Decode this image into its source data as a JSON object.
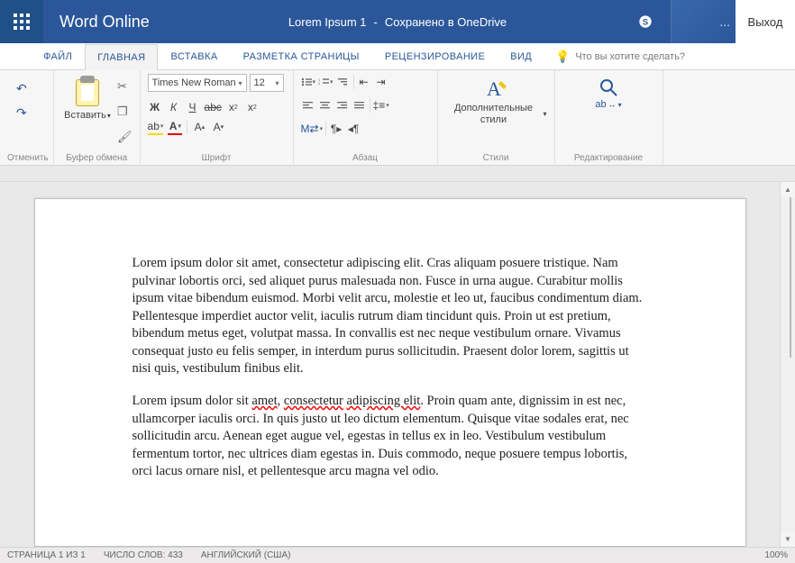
{
  "titlebar": {
    "app_name": "Word Online",
    "doc_name": "Lorem Ipsum 1",
    "save_status": "Сохранено в OneDrive",
    "ellipsis": "...",
    "exit": "Выход"
  },
  "tabs": {
    "file": "ФАЙЛ",
    "home": "ГЛАВНАЯ",
    "insert": "ВСТАВКА",
    "layout": "РАЗМЕТКА СТРАНИЦЫ",
    "review": "РЕЦЕНЗИРОВАНИЕ",
    "view": "ВИД",
    "tell_me": "Что вы хотите сделать?"
  },
  "ribbon": {
    "undo_group": "Отменить",
    "clipboard_group": "Буфер обмена",
    "paste": "Вставить",
    "font_group": "Шрифт",
    "font_name": "Times New Roman",
    "font_size": "12",
    "paragraph_group": "Абзац",
    "styles_group": "Стили",
    "styles_btn": "Дополнительные стили",
    "editing_group": "Редактирование",
    "find_icon_label": "ab"
  },
  "document": {
    "para1": "Lorem ipsum dolor sit amet, consectetur adipiscing elit. Cras aliquam posuere tristique. Nam pulvinar lobortis orci, sed aliquet purus malesuada non. Fusce in urna augue. Curabitur mollis ipsum vitae bibendum euismod. Morbi velit arcu, molestie et leo ut, faucibus condimentum diam. Pellentesque imperdiet auctor velit, iaculis rutrum diam tincidunt quis. Proin ut est pretium, bibendum metus eget, volutpat massa. In convallis est nec neque vestibulum ornare. Vivamus consequat justo eu felis semper, in interdum purus sollicitudin. Praesent dolor lorem, sagittis ut nisi quis, vestibulum finibus elit.",
    "para2_pre": "Lorem ipsum dolor sit ",
    "para2_err1": "amet",
    "para2_mid1": ", ",
    "para2_err2": "consectetur",
    "para2_mid2": " ",
    "para2_err3": "adipiscing elit",
    "para2_post": ". Proin quam ante, dignissim in est nec, ullamcorper iaculis orci. In quis justo ut leo dictum elementum. Quisque vitae sodales erat, nec sollicitudin arcu. Aenean eget augue vel, egestas in tellus ex in leo. Vestibulum vestibulum fermentum tortor, nec ultrices diam egestas in. Duis commodo, neque posuere tempus lobortis, orci lacus ornare nisl, et pellentesque arcu magna vel odio."
  },
  "status": {
    "page_info": "СТРАНИЦА 1 ИЗ 1",
    "word_count": "ЧИСЛО СЛОВ: 433",
    "language": "АНГЛИЙСКИЙ (США)",
    "zoom": "100%"
  }
}
